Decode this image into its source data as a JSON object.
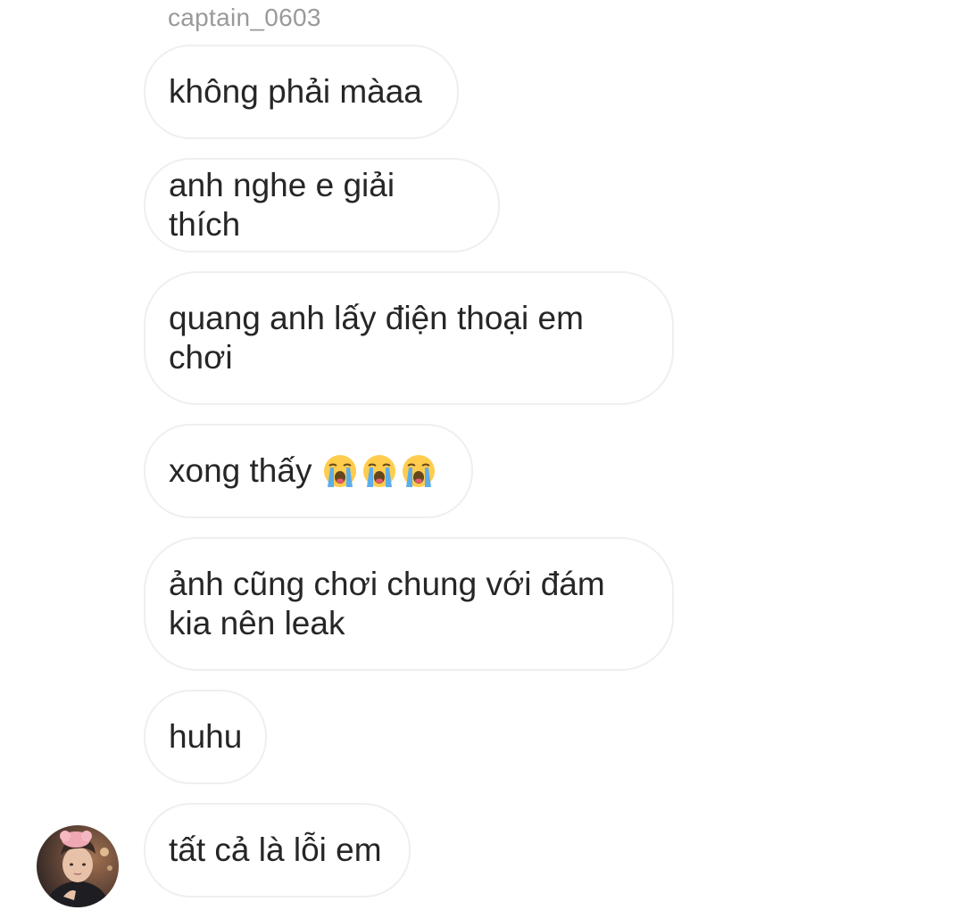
{
  "conversation": {
    "sender_username": "captain_0603",
    "messages": [
      {
        "text": "không phải màaa"
      },
      {
        "text": "anh nghe e giải thích"
      },
      {
        "text": "quang anh lấy điện thoại em\nchơi"
      },
      {
        "text": "xong thấy",
        "emojis": [
          "loudly-crying-face",
          "loudly-crying-face",
          "loudly-crying-face"
        ]
      },
      {
        "text": "ảnh cũng chơi chung với đám\nkia nên leak"
      },
      {
        "text": "huhu"
      },
      {
        "text": "tất cả là lỗi em"
      }
    ]
  },
  "colors": {
    "bubble_border": "#efefef",
    "text": "#262626",
    "username": "#9a9a9a",
    "emoji_face": "#ffcc4d",
    "emoji_tears": "#5dadec"
  }
}
